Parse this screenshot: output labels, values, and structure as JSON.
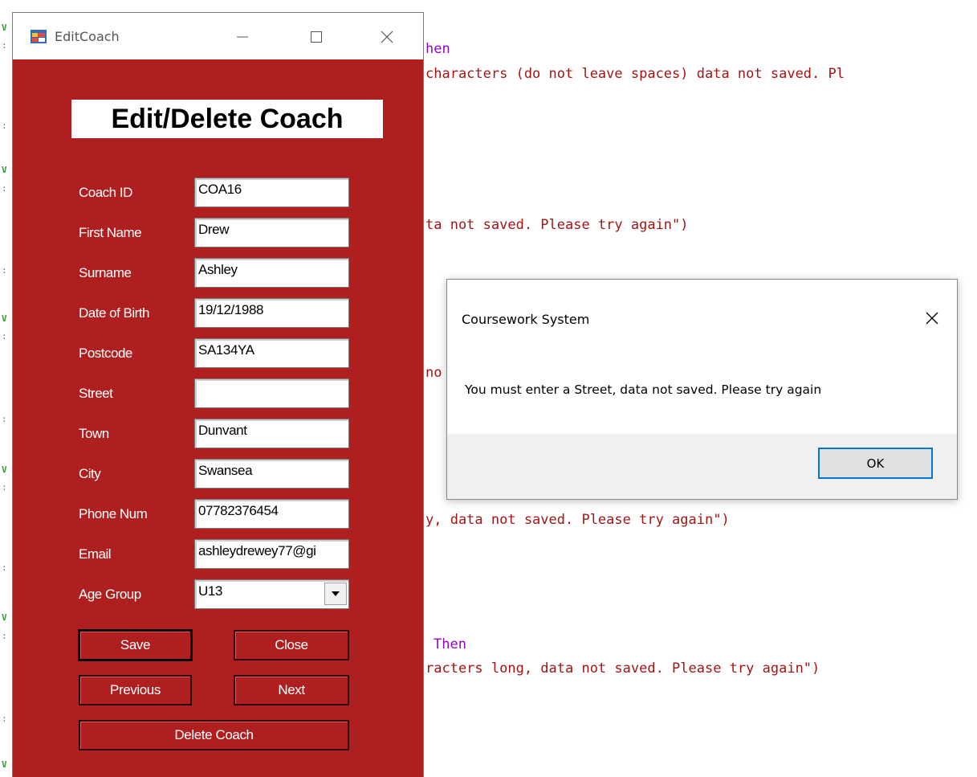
{
  "code_background": {
    "line1": "hen",
    "line2": "characters (do not leave spaces) data not saved. Pl",
    "line3": "ta not saved. Please try again\")",
    "line4": "no",
    "line5": "y, data not saved. Please try again\")",
    "line6": "Then",
    "line7": "racters long, data not saved. Please try again\")"
  },
  "window": {
    "title": "EditCoach",
    "heading": "Edit/Delete Coach",
    "fields": [
      {
        "label": "Coach ID",
        "value": "COA16"
      },
      {
        "label": "First Name",
        "value": "Drew"
      },
      {
        "label": "Surname",
        "value": "Ashley"
      },
      {
        "label": "Date of Birth",
        "value": "19/12/1988"
      },
      {
        "label": "Postcode",
        "value": "SA134YA"
      },
      {
        "label": "Street",
        "value": ""
      },
      {
        "label": "Town",
        "value": "Dunvant"
      },
      {
        "label": "City",
        "value": "Swansea"
      },
      {
        "label": "Phone Num",
        "value": "07782376454"
      },
      {
        "label": "Email",
        "value": "ashleydrewey77@gi"
      },
      {
        "label": "Age Group",
        "value": "U13"
      }
    ],
    "buttons": {
      "save": "Save",
      "close": "Close",
      "previous": "Previous",
      "next": "Next",
      "delete": "Delete Coach"
    },
    "colors": {
      "form_background": "#b01f1f"
    }
  },
  "message_box": {
    "title": "Coursework System",
    "message": "You must enter a Street, data not saved. Please try again",
    "ok_label": "OK"
  }
}
